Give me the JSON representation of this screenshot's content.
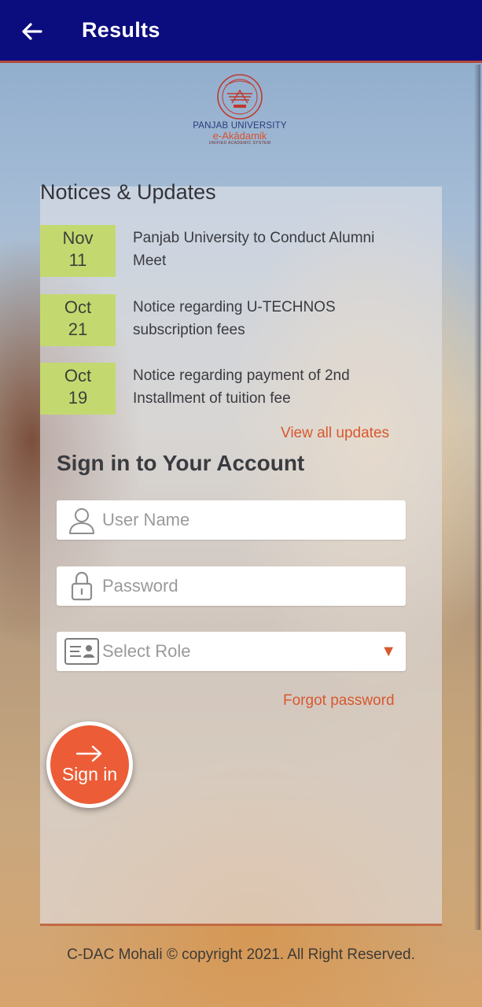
{
  "appbar": {
    "title": "Results",
    "background": "#0b0c7e",
    "back_icon": "arrow-left-icon"
  },
  "logo": {
    "university": "PANJAB UNIVERSITY",
    "product": "e-Akādamik",
    "tagline": "UNIFIED ACADEMIC SYSTEM"
  },
  "notices": {
    "title": "Notices & Updates",
    "items": [
      {
        "month": "Nov",
        "day": "11",
        "text": "Panjab University to Conduct Alumni Meet"
      },
      {
        "month": "Oct",
        "day": "21",
        "text": "Notice regarding U-TECHNOS subscription fees"
      },
      {
        "month": "Oct",
        "day": "19",
        "text": "Notice regarding payment of 2nd Installment of tuition fee"
      }
    ],
    "view_all": "View all updates"
  },
  "signin": {
    "title": "Sign in to Your Account",
    "username_placeholder": "User Name",
    "username_value": "",
    "password_placeholder": "Password",
    "password_value": "",
    "role_placeholder": "Select Role",
    "forgot_password": "Forgot password",
    "button_label": "Sign in",
    "accent_color": "#ec5c36"
  },
  "footer": {
    "text": "C-DAC Mohali © copyright 2021. All Right Reserved."
  }
}
